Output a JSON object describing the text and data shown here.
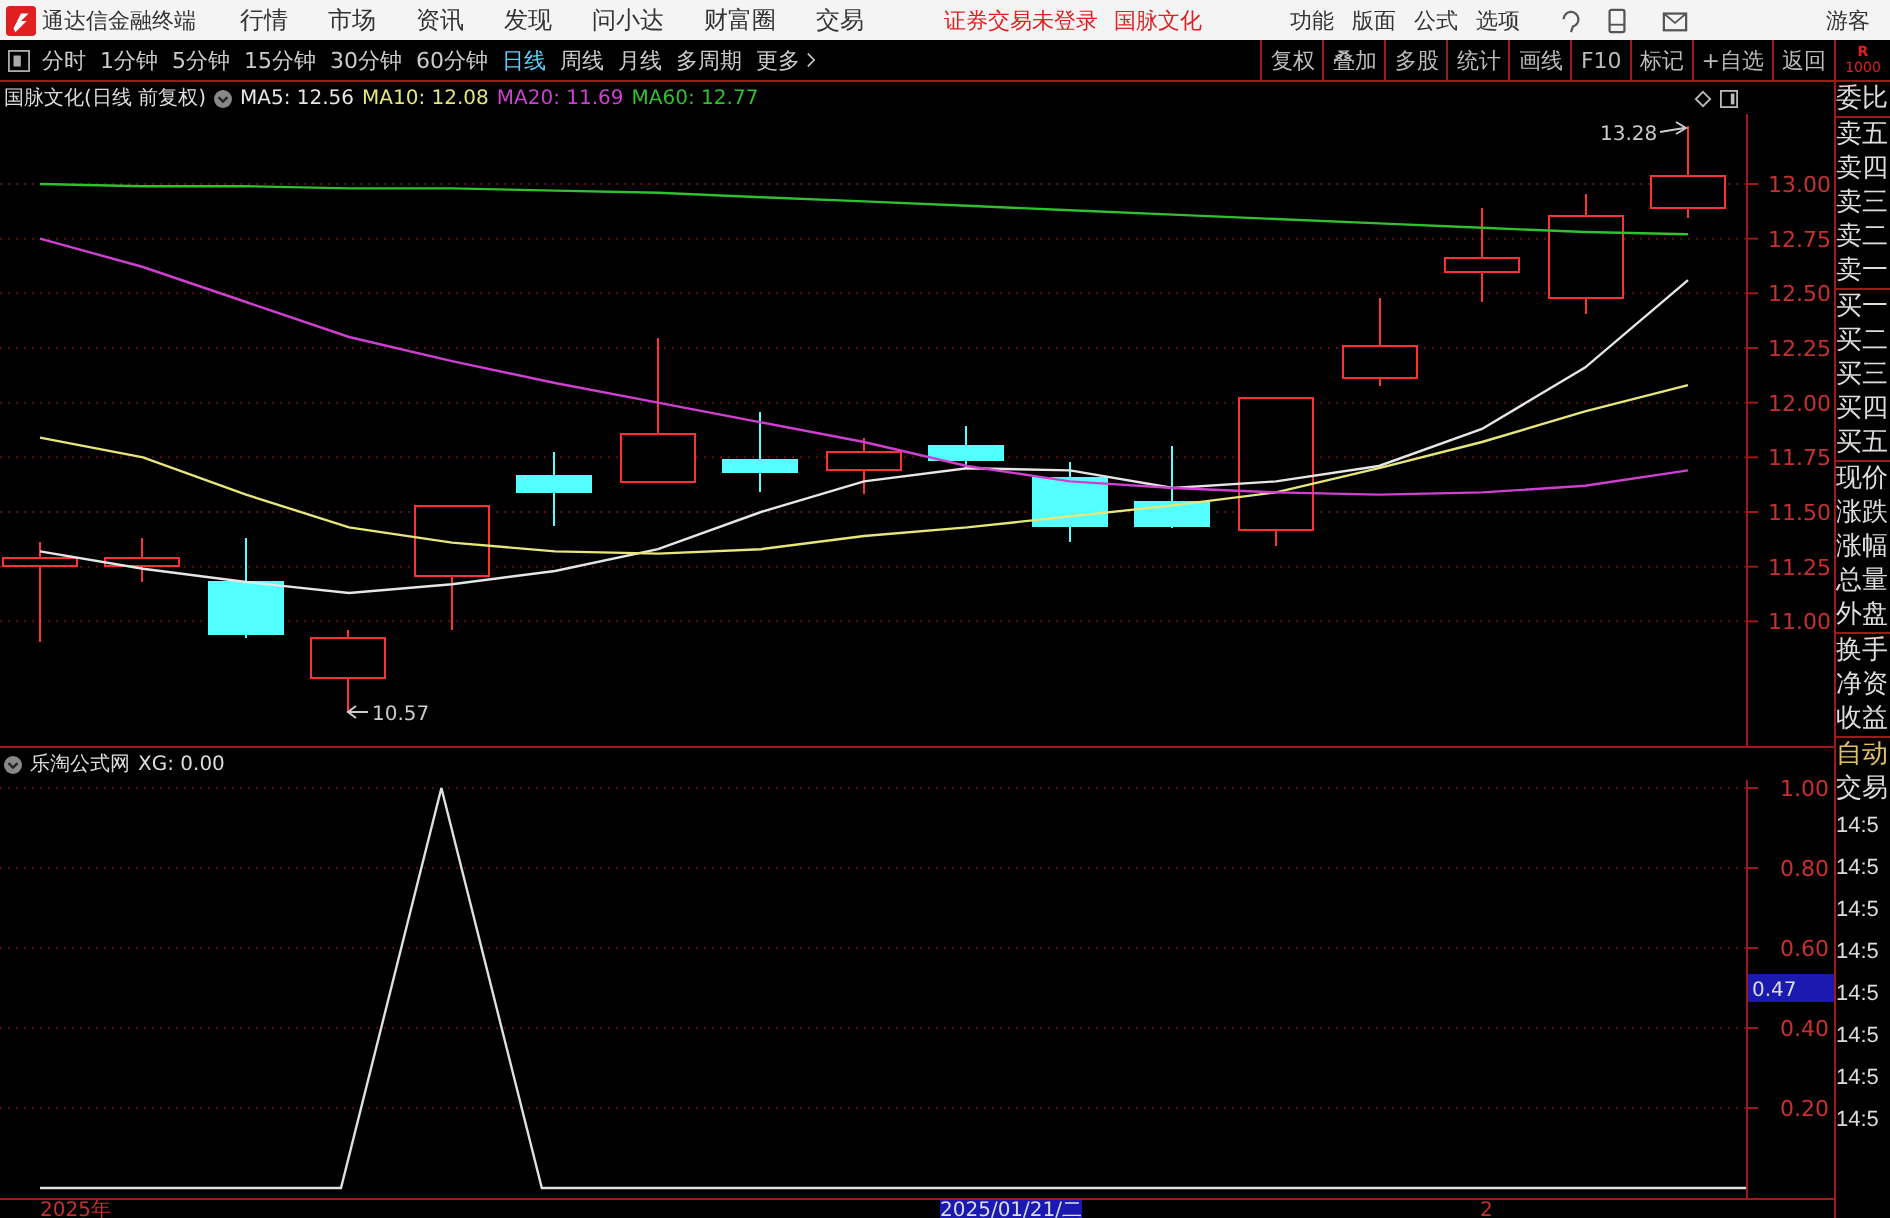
{
  "app": {
    "title": "通达信金融终端"
  },
  "menu": [
    "行情",
    "市场",
    "资讯",
    "发现",
    "问小达",
    "财富圈",
    "交易"
  ],
  "login_status": "证券交易未登录",
  "stock_name": "国脉文化",
  "right_menu": [
    "功能",
    "版面",
    "公式",
    "选项"
  ],
  "user": "游客",
  "periods": [
    {
      "label": "分时",
      "selected": false
    },
    {
      "label": "1分钟",
      "selected": false
    },
    {
      "label": "5分钟",
      "selected": false
    },
    {
      "label": "15分钟",
      "selected": false
    },
    {
      "label": "30分钟",
      "selected": false
    },
    {
      "label": "60分钟",
      "selected": false
    },
    {
      "label": "日线",
      "selected": true
    },
    {
      "label": "周线",
      "selected": false
    },
    {
      "label": "月线",
      "selected": false
    },
    {
      "label": "多周期",
      "selected": false
    }
  ],
  "more": "更多",
  "tools": [
    "复权",
    "叠加",
    "多股",
    "统计",
    "画线",
    "F10",
    "标记",
    "+自选",
    "返回"
  ],
  "main_chart": {
    "title": "国脉文化(日线 前复权)",
    "legend_values": [
      ": 12.56",
      ": 12.08",
      ": 11.69",
      ": 12.77"
    ],
    "high_label": "13.28",
    "low_label": "10.57",
    "chart_data": {
      "type": "line",
      "grid": true,
      "ylim": [
        10.43,
        13.32
      ],
      "yticks": [
        {
          "value": 13,
          "label": "13.00"
        },
        {
          "value": 12.75,
          "label": "12.75"
        },
        {
          "value": 12.5,
          "label": "12.50"
        },
        {
          "value": 12.25,
          "label": "12.25"
        },
        {
          "value": 12,
          "label": "12.00"
        },
        {
          "value": 11.75,
          "label": "11.75"
        },
        {
          "value": 11.5,
          "label": "11.50"
        },
        {
          "value": 11.25,
          "label": "11.25"
        },
        {
          "value": 11,
          "label": "11.00"
        }
      ],
      "series": [
        {
          "name": "MA5",
          "color": "#e6e6e6",
          "values": [
            11.32,
            11.24,
            11.18,
            11.13,
            11.17,
            11.23,
            11.33,
            11.5,
            11.64,
            11.7,
            11.69,
            11.61,
            11.64,
            11.71,
            11.88,
            12.16,
            12.56
          ]
        },
        {
          "name": "MA10",
          "color": "#e6e67a",
          "values": [
            11.84,
            11.75,
            11.58,
            11.43,
            11.36,
            11.32,
            11.31,
            11.33,
            11.39,
            11.43,
            11.48,
            11.53,
            11.59,
            11.7,
            11.82,
            11.96,
            12.08
          ]
        },
        {
          "name": "MA20",
          "color": "#d040d0",
          "values": [
            12.75,
            12.62,
            12.46,
            12.3,
            12.19,
            12.09,
            12,
            11.91,
            11.82,
            11.71,
            11.64,
            11.61,
            11.59,
            11.58,
            11.59,
            11.62,
            11.69
          ]
        },
        {
          "name": "MA60",
          "color": "#30c030",
          "values": [
            13,
            12.99,
            12.99,
            12.98,
            12.98,
            12.97,
            12.96,
            12.94,
            12.92,
            12.9,
            12.88,
            12.86,
            12.84,
            12.82,
            12.8,
            12.78,
            12.77
          ]
        }
      ]
    }
  },
  "sub_chart": {
    "title": "乐淘公式网",
    "legend_values": [
      ": 0.00"
    ],
    "cursor_value": "0.47",
    "chart_data": {
      "type": "line",
      "grid": true,
      "series": [
        {
          "name": "XG",
          "color": "#e0e0e0",
          "values": [
            0,
            0,
            0,
            0,
            1,
            0,
            0,
            0,
            0,
            0,
            0,
            0,
            0,
            0,
            0,
            0,
            0,
            0
          ]
        }
      ],
      "ylim": [
        -0.025,
        1.02
      ],
      "yticks": [
        {
          "value": 1,
          "label": "1.00"
        },
        {
          "value": 0.8,
          "label": "0.80"
        },
        {
          "value": 0.6,
          "label": "0.60"
        },
        {
          "value": 0.4,
          "label": "0.40"
        },
        {
          "value": 0.2,
          "label": "0.20"
        }
      ]
    }
  },
  "date_axis": [
    {
      "label": "2025年",
      "selected": false
    },
    {
      "label": "2025/01/21/二",
      "selected": true
    },
    {
      "label": "2",
      "selected": false
    }
  ],
  "quote_panel": {
    "badge": [
      "R",
      "1000"
    ],
    "groups": [
      [
        "委比"
      ],
      [
        "卖五",
        "卖四",
        "卖三",
        "卖二",
        "卖一"
      ],
      [
        "买一",
        "买二",
        "买三",
        "买四",
        "买五"
      ],
      [
        "现价",
        "涨跌",
        "涨幅",
        "总量",
        "外盘"
      ],
      [
        "换手",
        "净资",
        "收益"
      ]
    ],
    "trade_header": [
      "自动",
      "交易"
    ],
    "times": [
      "14:5",
      "14:5",
      "14:5",
      "14:5",
      "14:5",
      "14:5",
      "14:5",
      "14:5"
    ]
  }
}
